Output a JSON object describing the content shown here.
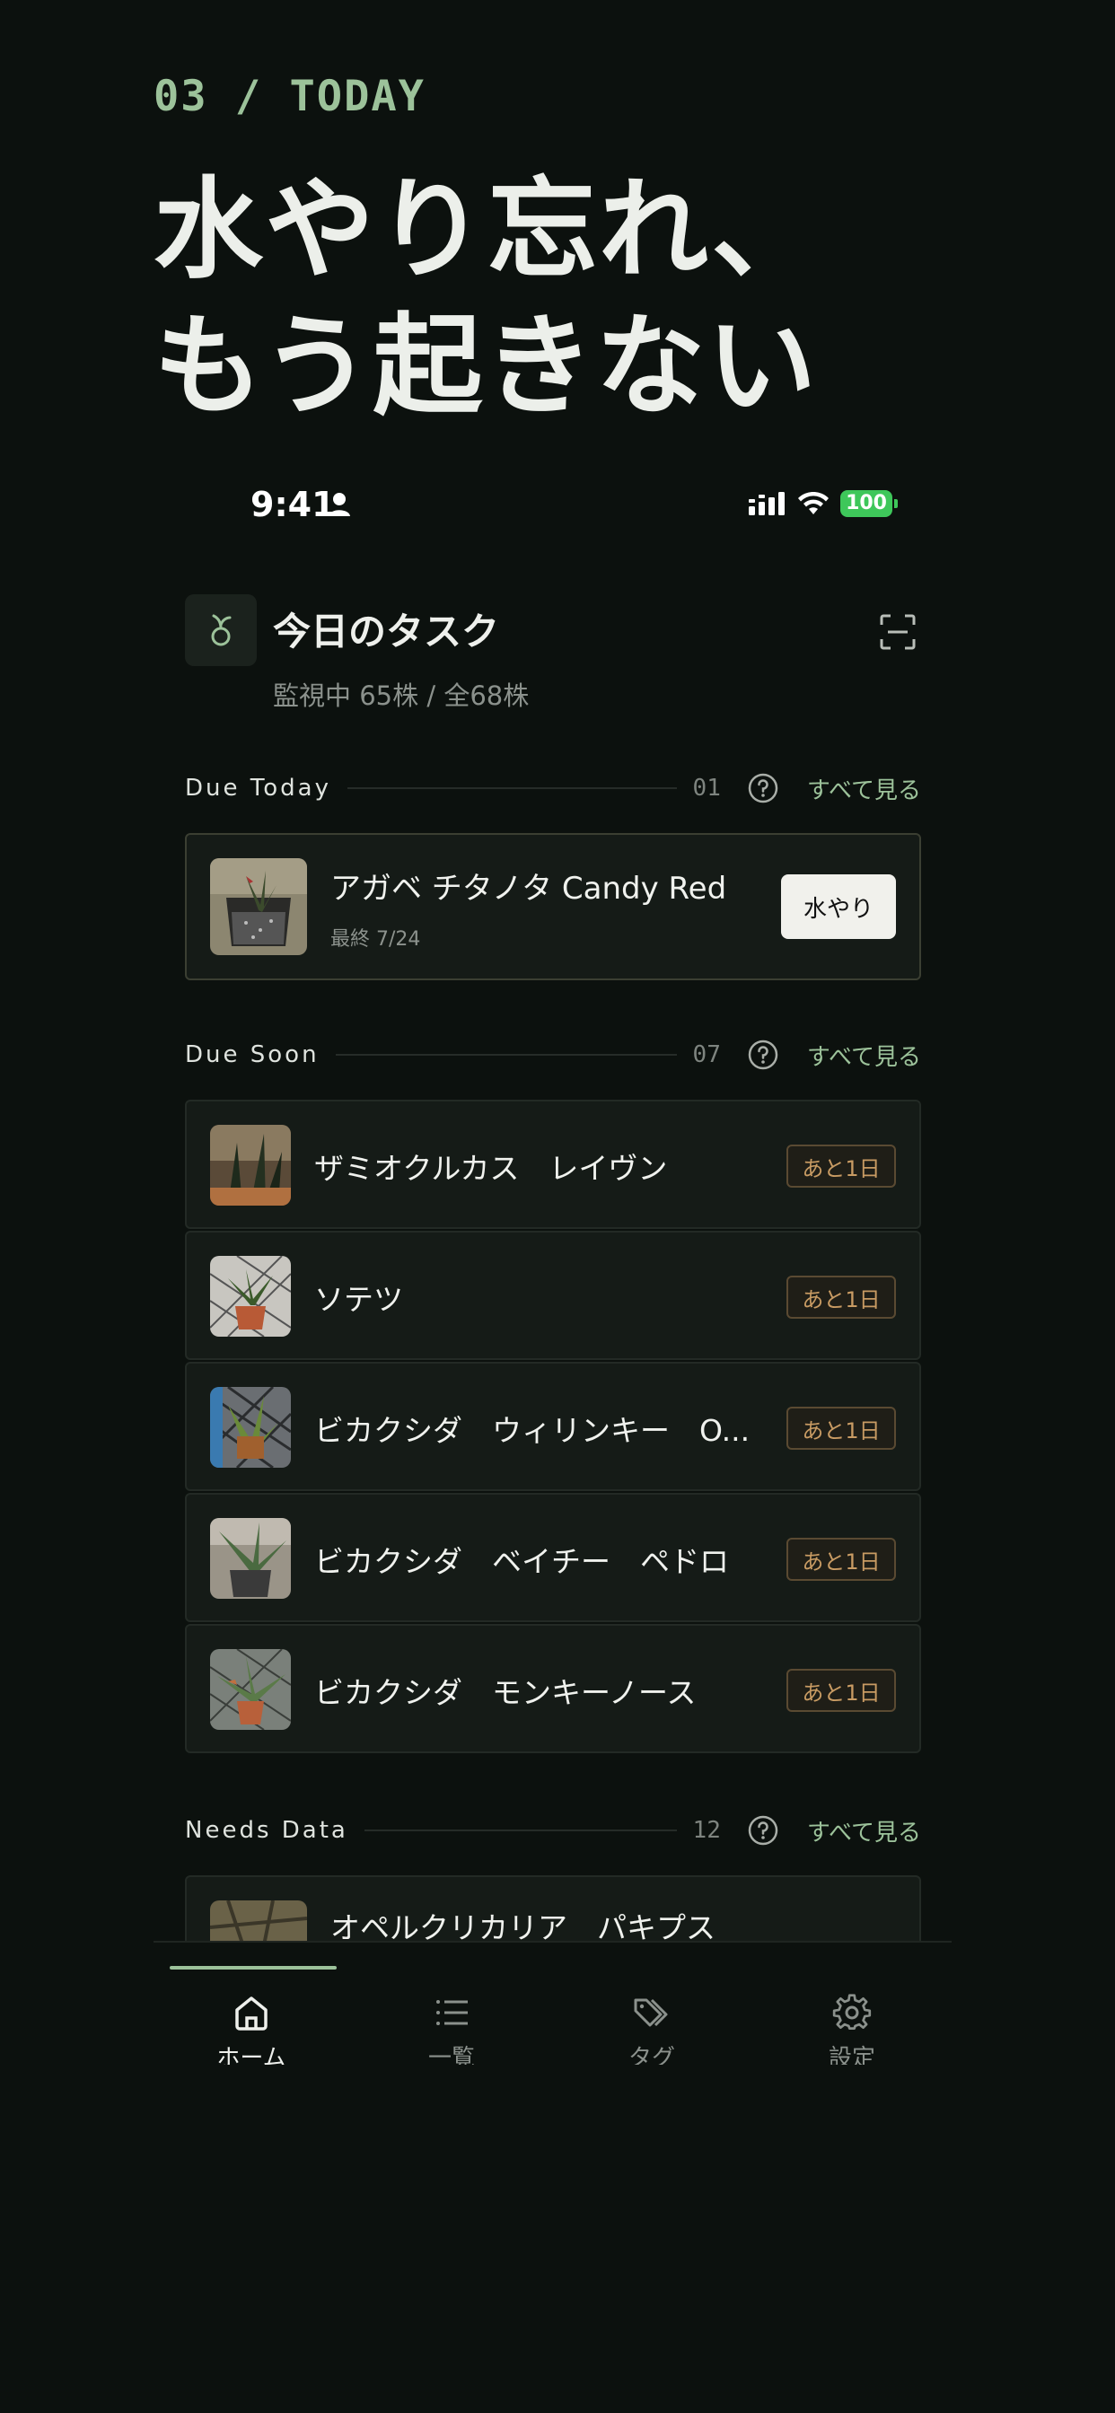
{
  "eyebrow": "03 / TODAY",
  "headline": {
    "line1": "水やり忘れ、",
    "line2": "もう起きない"
  },
  "status_bar": {
    "time": "9:41",
    "battery": "100"
  },
  "header": {
    "title": "今日のタスク",
    "subtitle": "監視中 65株 / 全68株"
  },
  "sections": {
    "due_today": {
      "title": "Due Today",
      "count": "01",
      "see_all": "すべて見る"
    },
    "due_soon": {
      "title": "Due Soon",
      "count": "07",
      "see_all": "すべて見る"
    },
    "needs_data": {
      "title": "Needs Data",
      "count": "12",
      "see_all": "すべて見る"
    }
  },
  "today_items": [
    {
      "name": "アガベ チタノタ Candy Red",
      "last": "最終 7/24",
      "action": "水やり"
    }
  ],
  "soon_items": [
    {
      "name": "ザミオクルカス　レイヴン",
      "badge": "あと1日"
    },
    {
      "name": "ソテツ",
      "badge": "あと1日"
    },
    {
      "name": "ビカクシダ　ウィリンキー　O...",
      "badge": "あと1日"
    },
    {
      "name": "ビカクシダ　ベイチー　ペドロ",
      "badge": "あと1日"
    },
    {
      "name": "ビカクシダ　モンキーノース",
      "badge": "あと1日"
    }
  ],
  "needs_items": [
    {
      "name": "オペルクリカリア　パキプス"
    }
  ],
  "tabs": [
    {
      "label": "ホーム",
      "icon": "home-icon",
      "active": true
    },
    {
      "label": "一覧",
      "icon": "list-icon",
      "active": false
    },
    {
      "label": "タグ",
      "icon": "tag-icon",
      "active": false
    },
    {
      "label": "設定",
      "icon": "settings-icon",
      "active": false
    }
  ],
  "colors": {
    "background": "#0c110e",
    "accent": "#9cc29a",
    "card": "#151b17",
    "badge_text": "#c89b63"
  }
}
